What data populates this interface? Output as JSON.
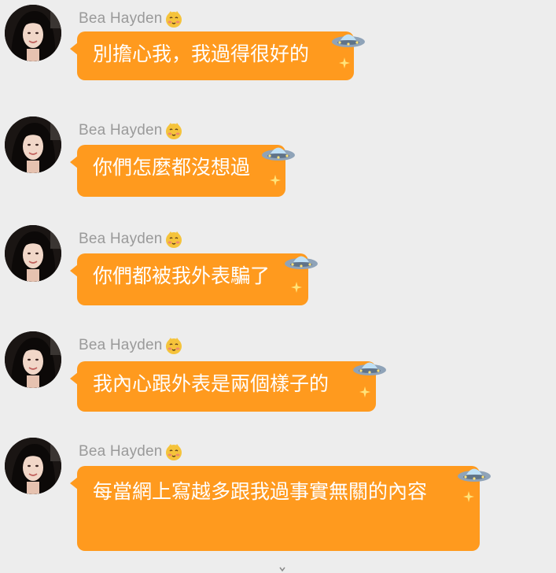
{
  "chat": {
    "messages": [
      {
        "sender": "Bea Hayden",
        "text": "別擔心我，我過得很好的"
      },
      {
        "sender": "Bea Hayden",
        "text": "你們怎麼都沒想過"
      },
      {
        "sender": "Bea Hayden",
        "text": "你們都被我外表騙了"
      },
      {
        "sender": "Bea Hayden",
        "text": "我內心跟外表是兩個樣子的"
      },
      {
        "sender": "Bea Hayden",
        "text": "每當網上寫越多跟我過事實無關的內容"
      }
    ]
  },
  "icons": {
    "sender_badge": "blushing-emoji-icon",
    "bubble_decoration": "ufo-icon",
    "sparkle": "sparkle-icon",
    "scroll": "chevron-down-icon"
  },
  "colors": {
    "background": "#ededed",
    "bubble": "#ff9a1e",
    "bubble_text": "#ffffff",
    "sender_text": "#9a9a9a"
  }
}
